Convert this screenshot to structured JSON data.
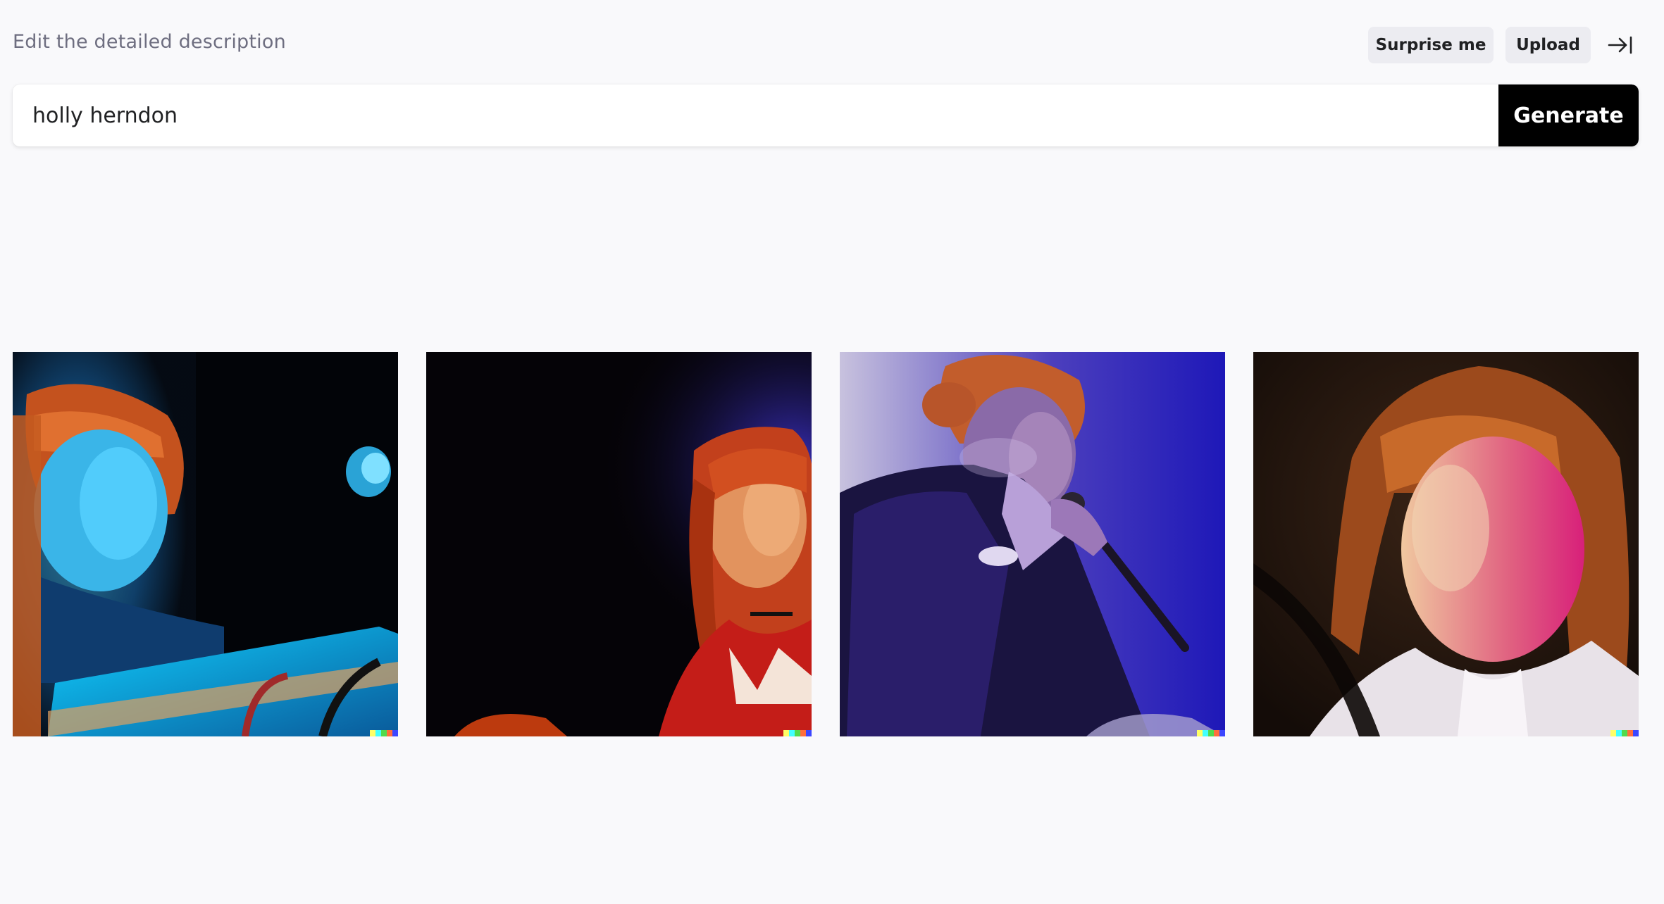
{
  "header": {
    "label": "Edit the detailed description",
    "surprise_label": "Surprise me",
    "upload_label": "Upload",
    "collapse_icon": "arrow-right-to-bar-icon"
  },
  "prompt": {
    "value": "holly herndon",
    "generate_label": "Generate"
  },
  "results": [
    {
      "scene": "performer-at-keyboard-cyan-light"
    },
    {
      "scene": "performer-red-hair-dark-stage"
    },
    {
      "scene": "performer-singing-into-microphone-blue-light"
    },
    {
      "scene": "performer-closeup-pink-light"
    }
  ],
  "colors": {
    "background": "#f9f9fb",
    "chip": "#ececf1",
    "generate_bg": "#000000",
    "generate_text": "#ffffff",
    "watermark": [
      "#ffff66",
      "#42ffff",
      "#51da4c",
      "#ff6e3c",
      "#3c46ff"
    ]
  }
}
